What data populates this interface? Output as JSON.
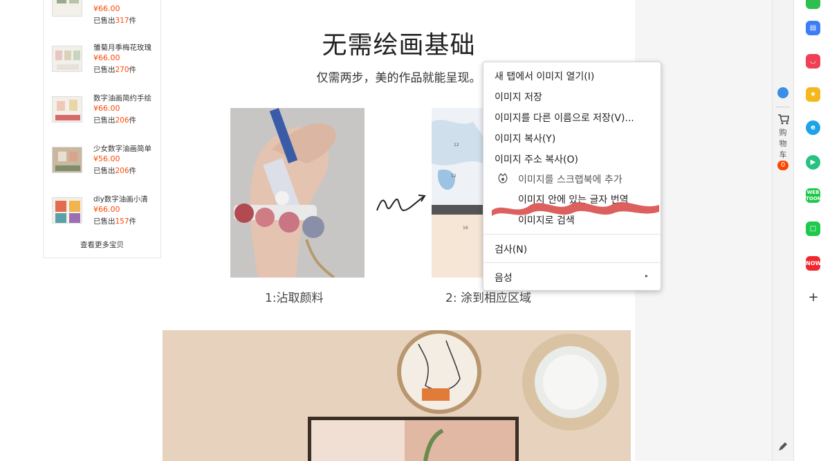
{
  "products": [
    {
      "name": "",
      "price": "¥66.00",
      "sold_prefix": "已售出",
      "sold_count": "317",
      "sold_suffix": "件"
    },
    {
      "name": "雏菊月季梅花玫瑰",
      "price": "¥66.00",
      "sold_prefix": "已售出",
      "sold_count": "270",
      "sold_suffix": "件"
    },
    {
      "name": "数字油画简约手绘",
      "price": "¥66.00",
      "sold_prefix": "已售出",
      "sold_count": "206",
      "sold_suffix": "件"
    },
    {
      "name": "少女数字油画简单",
      "price": "¥56.00",
      "sold_prefix": "已售出",
      "sold_count": "206",
      "sold_suffix": "件"
    },
    {
      "name": "diy数字油画小清",
      "price": "¥66.00",
      "sold_prefix": "已售出",
      "sold_count": "157",
      "sold_suffix": "件"
    }
  ],
  "more_link": "查看更多宝贝",
  "heading": "无需绘画基础",
  "subheading": "仅需两步，美的作品就能呈现。",
  "step1": "1:沾取颜料",
  "step2": "2: 涂到相应区域",
  "cart": {
    "label": "购物车",
    "count": "0"
  },
  "side_icons": [
    "green-app-icon",
    "briefcase-icon",
    "pocket-icon",
    "star-icon",
    "edge-icon",
    "play-icon",
    "webtoon-icon",
    "line-icon",
    "now-icon",
    "plus-icon"
  ],
  "context_menu": {
    "items": [
      "새 탭에서 이미지 열기(I)",
      "이미지 저장",
      "이미지를 다른 이름으로 저장(V)...",
      "이미지 복사(Y)",
      "이미지 주소 복사(O)",
      "이미지를 스크랩북에 추가",
      "이미지 안에 있는 글자 번역",
      "이미지로 검색",
      "검사(N)",
      "음성"
    ]
  },
  "colors": {
    "accent": "#ff4400",
    "redact": "#d9534f"
  }
}
